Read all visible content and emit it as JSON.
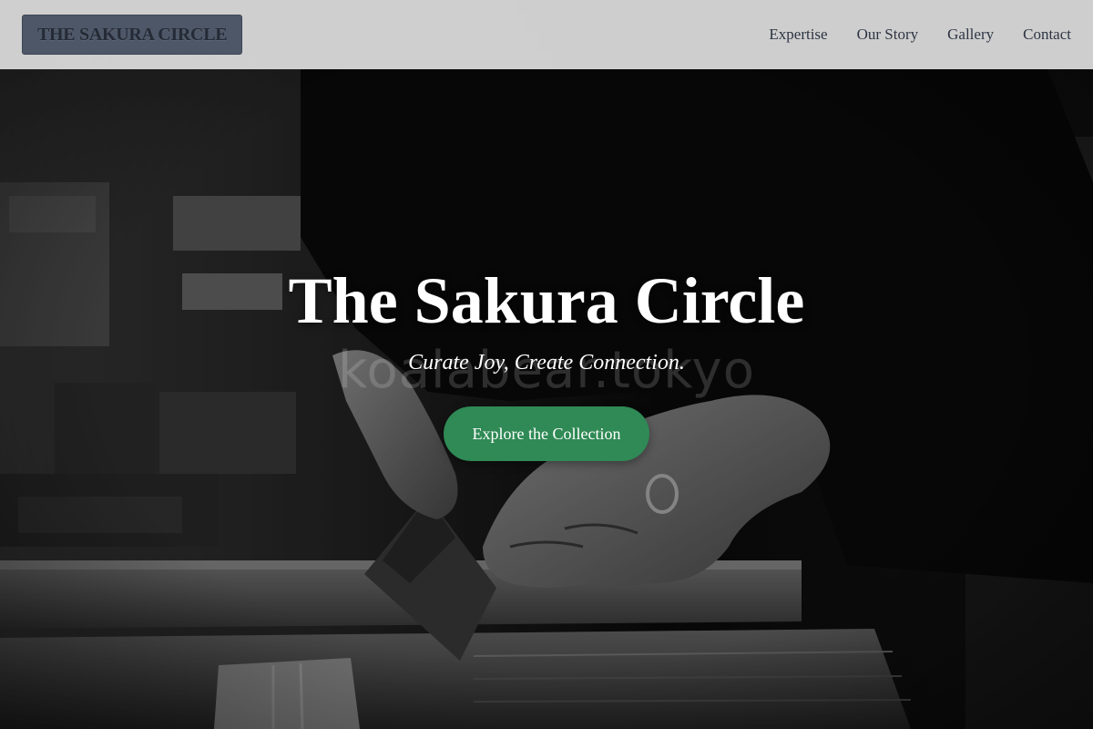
{
  "header": {
    "logo_text": "THE SAKURA CIRCLE",
    "nav": [
      {
        "label": "Expertise"
      },
      {
        "label": "Our Story"
      },
      {
        "label": "Gallery"
      },
      {
        "label": "Contact"
      }
    ]
  },
  "hero": {
    "title": "The Sakura Circle",
    "watermark": "koalabear.tokyo",
    "tagline": "Curate Joy, Create Connection.",
    "cta_label": "Explore the Collection",
    "image_subject": "craftsman-sawing-wood-photo"
  },
  "colors": {
    "header_bg": "#dedede",
    "logo_bg": "#4d5768",
    "logo_text": "#252b36",
    "nav_text": "#2c3442",
    "cta_bg": "#2f8a55",
    "hero_text": "#ffffff"
  }
}
